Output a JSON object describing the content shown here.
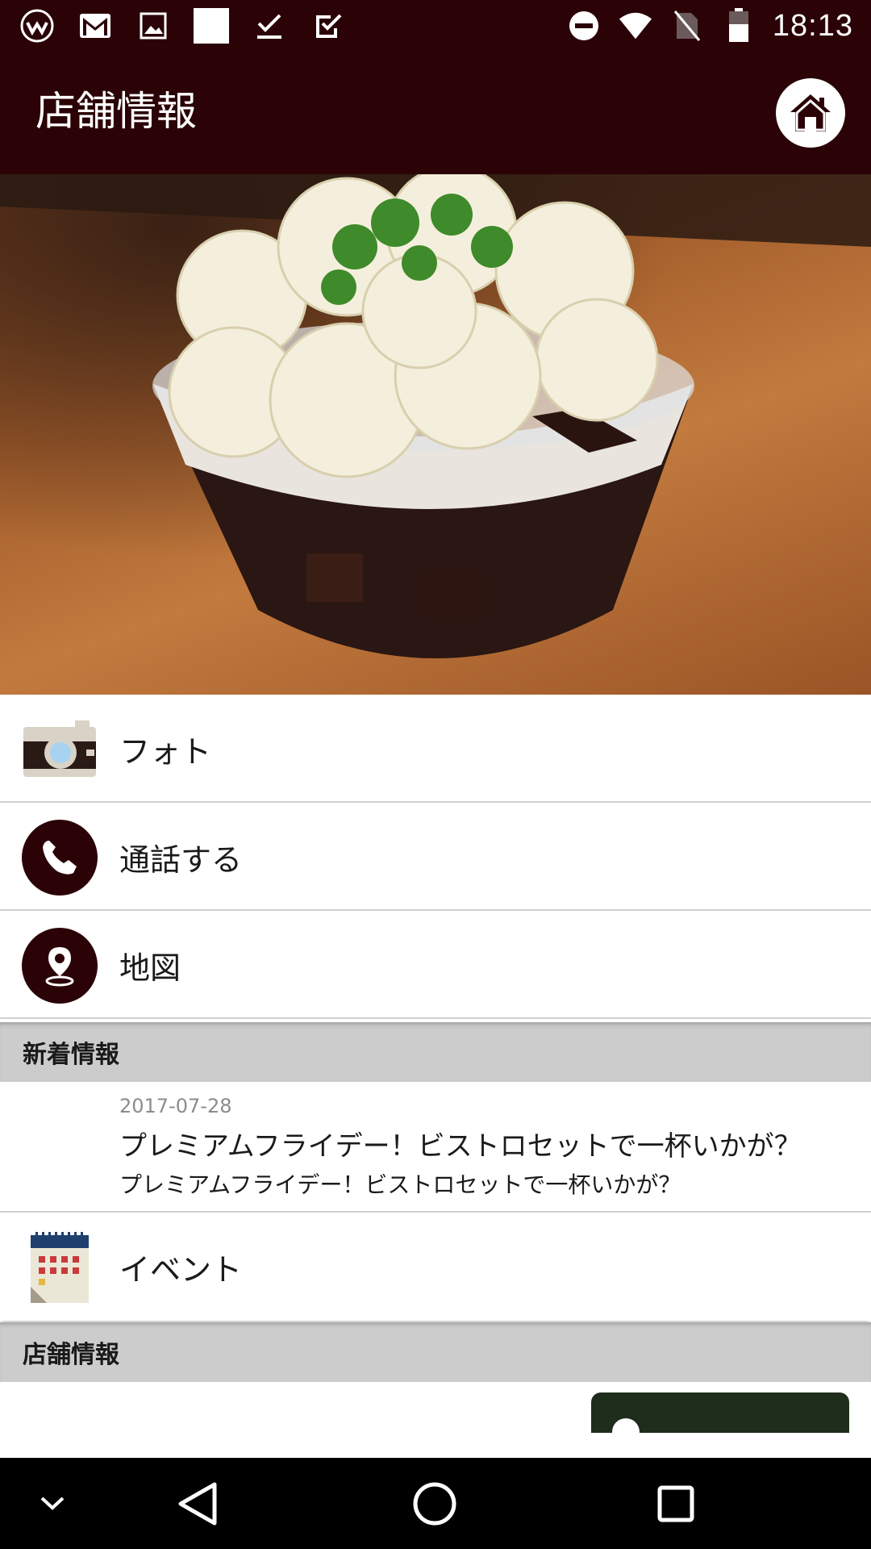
{
  "status_bar": {
    "time": "18:13",
    "left_icons": [
      "app-logo-icon",
      "mail-icon",
      "image-icon",
      "white-square-icon",
      "check-icon",
      "checkbox-icon"
    ],
    "right_icons": [
      "do-not-disturb-icon",
      "wifi-icon",
      "no-sim-icon",
      "battery-icon"
    ]
  },
  "app_bar": {
    "title": "店舗情報",
    "home_icon": "home-icon"
  },
  "hero": {
    "description_icon": "dessert-photo"
  },
  "menu": [
    {
      "label": "フォト",
      "icon": "camera-icon"
    },
    {
      "label": "通話する",
      "icon": "phone-icon"
    },
    {
      "label": "地図",
      "icon": "map-pin-icon"
    }
  ],
  "sections": {
    "news_header": "新着情報",
    "store_header": "店舗情報"
  },
  "news": {
    "date": "2017-07-28",
    "title": "プレミアムフライデー！ビストロセットで一杯いかが？",
    "body": "プレミアムフライデー！ビストロセットで一杯いかが？"
  },
  "event": {
    "label": "イベント",
    "icon": "calendar-icon"
  },
  "colors": {
    "brand_dark": "#2b0306",
    "section_gray": "#cccccc",
    "card_green": "#1f2e1c"
  },
  "nav_bar": [
    "collapse-icon",
    "back-icon",
    "home-circle-icon",
    "recents-icon"
  ]
}
